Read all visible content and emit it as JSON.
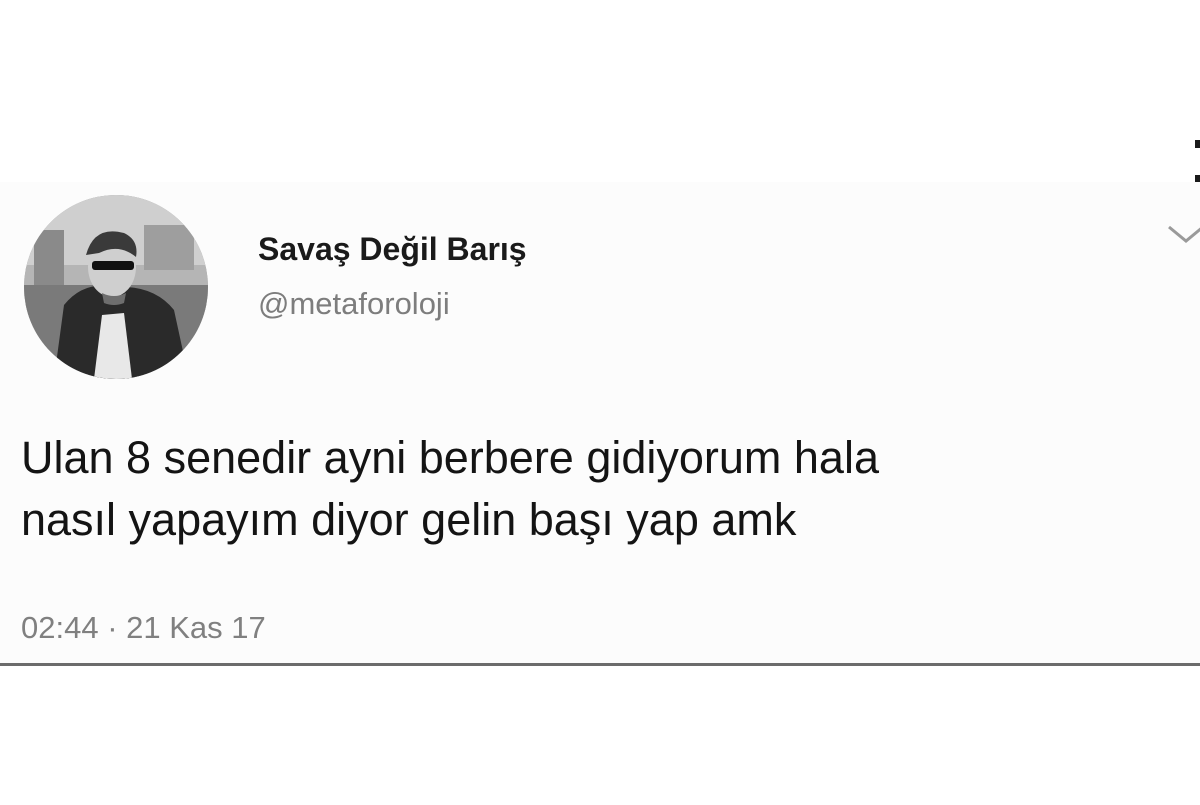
{
  "tweet": {
    "display_name": "Savaş Değil Barış",
    "handle": "@metaforoloji",
    "text_line_1": "Ulan 8 senedir ayni berbere gidiyorum hala",
    "text_line_2": "nasıl yapayım diyor gelin başı yap amk",
    "time": "02:44",
    "separator": "·",
    "date": "21 Kas 17"
  },
  "icons": {
    "more_menu": "chevron-down-icon",
    "avatar": "profile-photo"
  },
  "colors": {
    "name": "#1a1a1a",
    "secondary_text": "#7d7d7d",
    "divider": "#6b6b6b"
  }
}
